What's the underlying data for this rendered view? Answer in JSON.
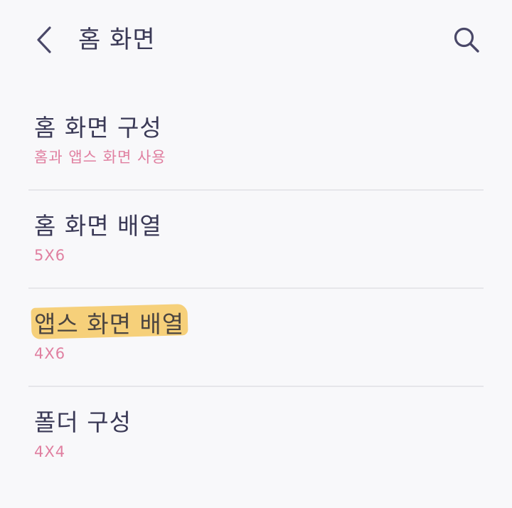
{
  "header": {
    "title": "홈 화면",
    "back_icon": "chevron-left-icon",
    "search_icon": "search-icon"
  },
  "settings": {
    "items": [
      {
        "title": "홈 화면 구성",
        "subtitle": "홈과 앱스 화면 사용"
      },
      {
        "title": "홈 화면 배열",
        "subtitle": "5X6"
      },
      {
        "title": "앱스 화면 배열",
        "subtitle": "4X6"
      },
      {
        "title": "폴더 구성",
        "subtitle": "4X4"
      }
    ]
  },
  "colors": {
    "title_text": "#3a3956",
    "subtitle_text": "#e07fa0",
    "highlight": "#f5c456",
    "background": "#f8f8fa",
    "divider": "#e6e6ea"
  }
}
